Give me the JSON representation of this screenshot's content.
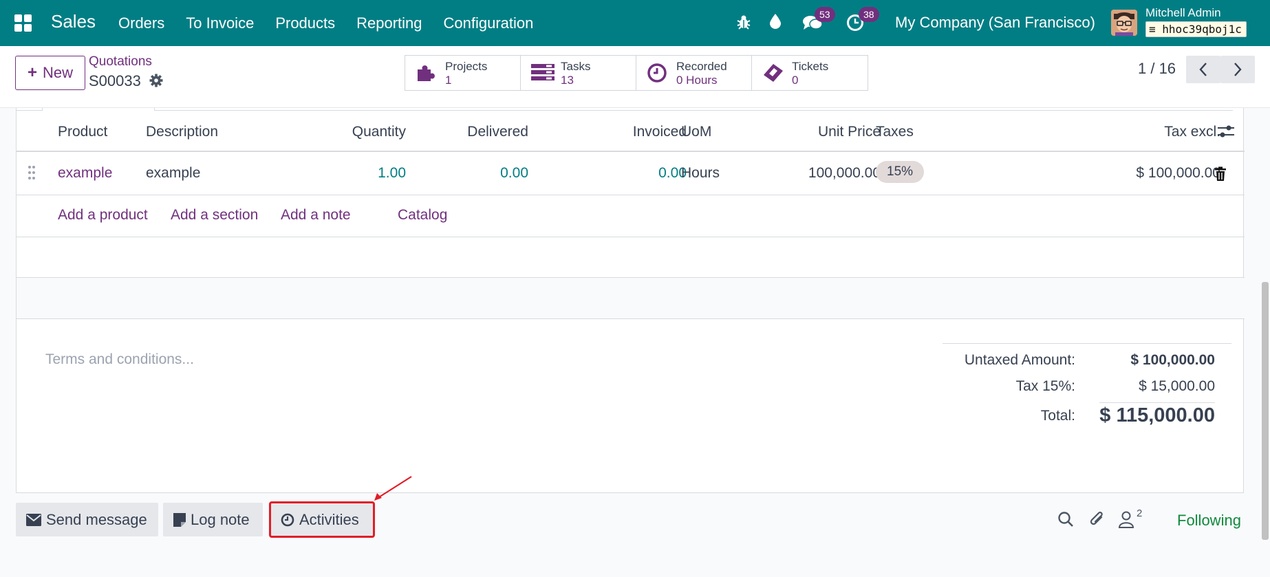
{
  "navbar": {
    "app_name": "Sales",
    "menu": [
      "Orders",
      "To Invoice",
      "Products",
      "Reporting",
      "Configuration"
    ],
    "messages_count": "53",
    "activities_count": "38",
    "company": "My Company (San Francisco)",
    "user_name": "Mitchell Admin",
    "database": "hhoc39qboj1c",
    "bg_color": "#017e84"
  },
  "control": {
    "new_label": "New",
    "breadcrumb_parent": "Quotations",
    "record_name": "S00033",
    "smart_buttons": [
      {
        "label": "Projects",
        "value": "1",
        "icon": "puzzle-icon"
      },
      {
        "label": "Tasks",
        "value": "13",
        "icon": "tasks-icon"
      },
      {
        "label": "Recorded",
        "value": "0 Hours",
        "icon": "clock-icon"
      },
      {
        "label": "Tickets",
        "value": "0",
        "icon": "ticket-icon"
      }
    ],
    "pager": "1 / 16"
  },
  "order_lines": {
    "headers": {
      "product": "Product",
      "description": "Description",
      "quantity": "Quantity",
      "delivered": "Delivered",
      "invoiced": "Invoiced",
      "uom": "UoM",
      "unit_price": "Unit Price",
      "taxes": "Taxes",
      "subtotal": "Tax excl."
    },
    "rows": [
      {
        "product": "example",
        "description": "example",
        "quantity": "1.00",
        "delivered": "0.00",
        "invoiced": "0.00",
        "uom": "Hours",
        "unit_price": "100,000.00",
        "taxes": "15%",
        "subtotal": "$ 100,000.00"
      }
    ],
    "actions": {
      "add_product": "Add a product",
      "add_section": "Add a section",
      "add_note": "Add a note",
      "catalog": "Catalog"
    }
  },
  "footer": {
    "terms_placeholder": "Terms and conditions...",
    "untaxed_label": "Untaxed Amount:",
    "untaxed_value": "$ 100,000.00",
    "tax_label": "Tax 15%:",
    "tax_value": "$ 15,000.00",
    "total_label": "Total:",
    "total_value": "$ 115,000.00"
  },
  "chatter": {
    "send_message": "Send message",
    "log_note": "Log note",
    "activities": "Activities",
    "followers_count": "2",
    "following": "Following"
  },
  "colors": {
    "accent": "#71307e",
    "link_numeric": "#017e84",
    "following": "#10893e",
    "highlight": "#e11d27"
  }
}
